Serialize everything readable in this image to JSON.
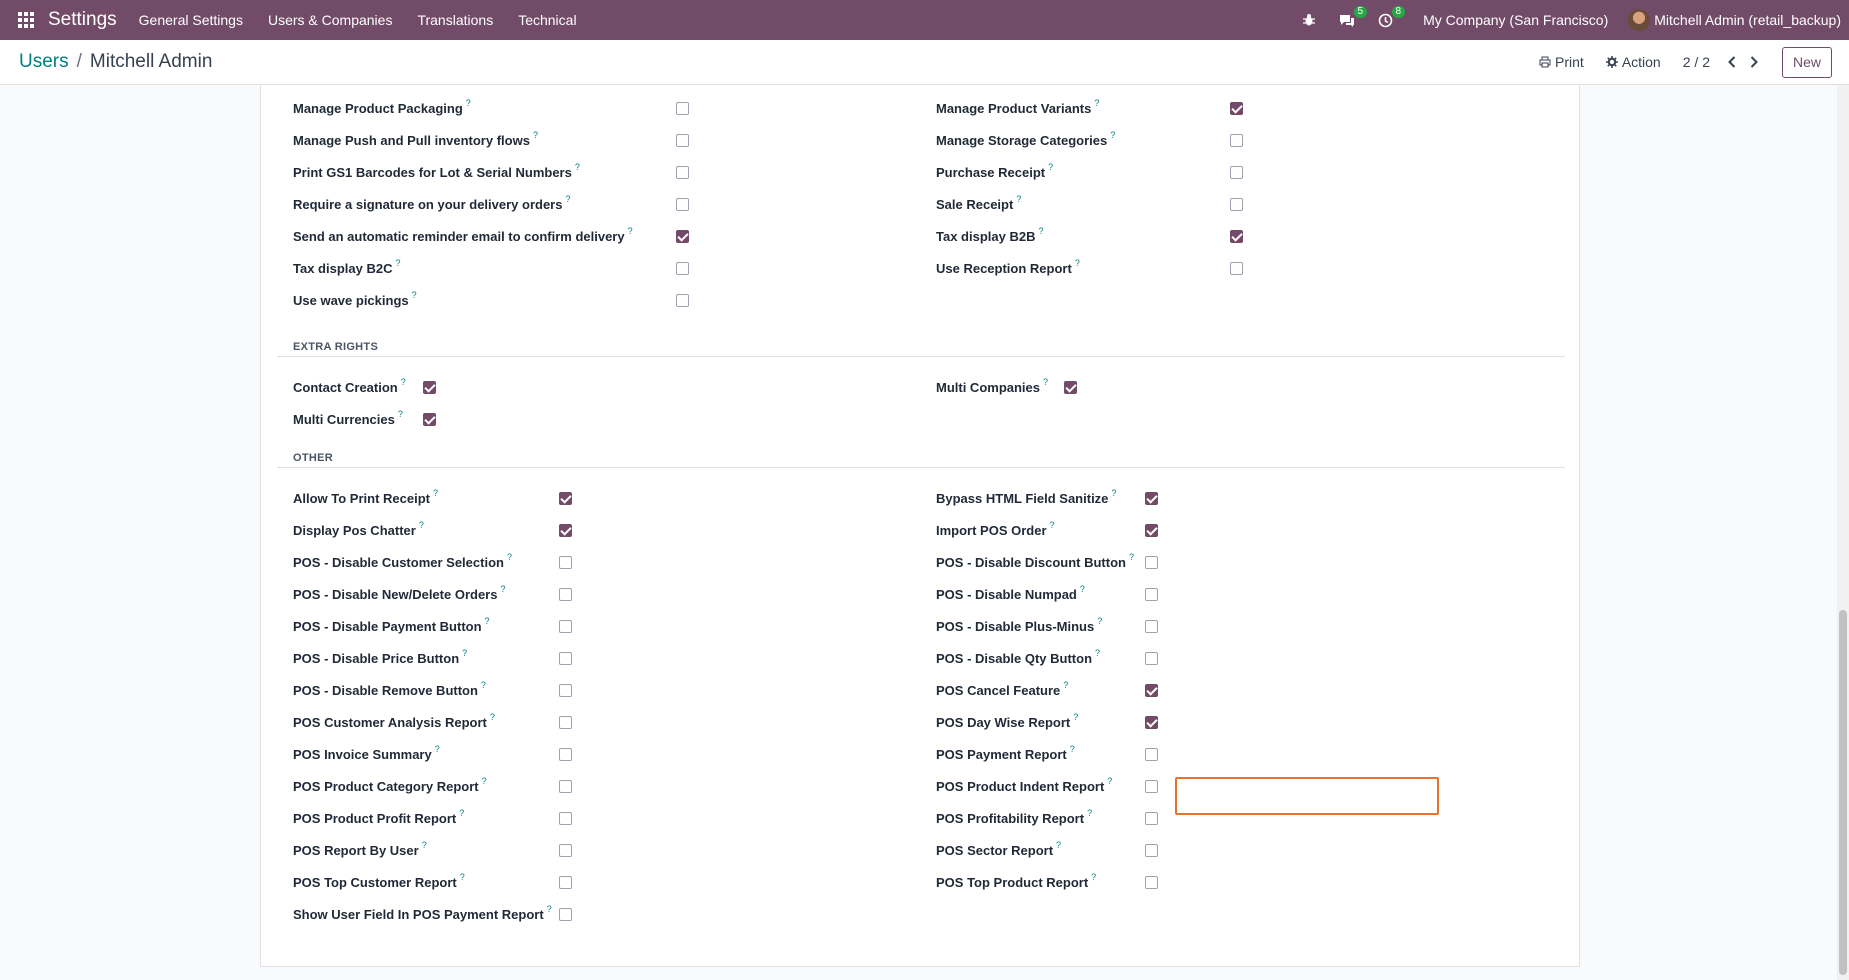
{
  "navbar": {
    "brand": "Settings",
    "menu": [
      "General Settings",
      "Users & Companies",
      "Translations",
      "Technical"
    ],
    "messages_count": "5",
    "activities_count": "8",
    "company": "My Company (San Francisco)",
    "user": "Mitchell Admin (retail_backup)"
  },
  "control_panel": {
    "breadcrumb_parent": "Users",
    "breadcrumb_separator": "/",
    "breadcrumb_current": "Mitchell Admin",
    "print_label": "Print",
    "action_label": "Action",
    "pager": "2 / 2",
    "new_label": "New"
  },
  "sections": {
    "inventory_left": [
      {
        "label": "Manage Product Packaging",
        "checked": false
      },
      {
        "label": "Manage Push and Pull inventory flows",
        "checked": false
      },
      {
        "label": "Print GS1 Barcodes for Lot & Serial Numbers",
        "checked": false
      },
      {
        "label": "Require a signature on your delivery orders",
        "checked": false
      },
      {
        "label": "Send an automatic reminder email to confirm delivery",
        "checked": true
      },
      {
        "label": "Tax display B2C",
        "checked": false
      },
      {
        "label": "Use wave pickings",
        "checked": false
      }
    ],
    "inventory_right": [
      {
        "label": "Manage Product Variants",
        "checked": true
      },
      {
        "label": "Manage Storage Categories",
        "checked": false
      },
      {
        "label": "Purchase Receipt",
        "checked": false
      },
      {
        "label": "Sale Receipt",
        "checked": false
      },
      {
        "label": "Tax display B2B",
        "checked": true
      },
      {
        "label": "Use Reception Report",
        "checked": false
      }
    ],
    "extra_rights_title": "EXTRA RIGHTS",
    "extra_left": [
      {
        "label": "Contact Creation",
        "checked": true
      },
      {
        "label": "Multi Currencies",
        "checked": true
      }
    ],
    "extra_right": [
      {
        "label": "Multi Companies",
        "checked": true
      }
    ],
    "other_title": "OTHER",
    "other_left": [
      {
        "label": "Allow To Print Receipt",
        "checked": true
      },
      {
        "label": "Display Pos Chatter",
        "checked": true
      },
      {
        "label": "POS - Disable Customer Selection",
        "checked": false
      },
      {
        "label": "POS - Disable New/Delete Orders",
        "checked": false
      },
      {
        "label": "POS - Disable Payment Button",
        "checked": false
      },
      {
        "label": "POS - Disable Price Button",
        "checked": false
      },
      {
        "label": "POS - Disable Remove Button",
        "checked": false
      },
      {
        "label": "POS Customer Analysis Report",
        "checked": false
      },
      {
        "label": "POS Invoice Summary",
        "checked": false
      },
      {
        "label": "POS Product Category Report",
        "checked": false
      },
      {
        "label": "POS Product Profit Report",
        "checked": false
      },
      {
        "label": "POS Report By User",
        "checked": false
      },
      {
        "label": "POS Top Customer Report",
        "checked": false
      },
      {
        "label": "Show User Field In POS Payment Report",
        "checked": false
      }
    ],
    "other_right": [
      {
        "label": "Bypass HTML Field Sanitize",
        "checked": true
      },
      {
        "label": "Import POS Order",
        "checked": true
      },
      {
        "label": "POS - Disable Discount Button",
        "checked": false
      },
      {
        "label": "POS - Disable Numpad",
        "checked": false
      },
      {
        "label": "POS - Disable Plus-Minus",
        "checked": false
      },
      {
        "label": "POS - Disable Qty Button",
        "checked": false
      },
      {
        "label": "POS Cancel Feature",
        "checked": true
      },
      {
        "label": "POS Day Wise Report",
        "checked": true
      },
      {
        "label": "POS Payment Report",
        "checked": false
      },
      {
        "label": "POS Product Indent Report",
        "checked": false
      },
      {
        "label": "POS Profitability Report",
        "checked": false
      },
      {
        "label": "POS Sector Report",
        "checked": false
      },
      {
        "label": "POS Top Product Report",
        "checked": false
      }
    ],
    "help_marker": "?"
  },
  "colors": {
    "brand": "#714b67",
    "link": "#017e84",
    "highlight": "#e8712b"
  }
}
